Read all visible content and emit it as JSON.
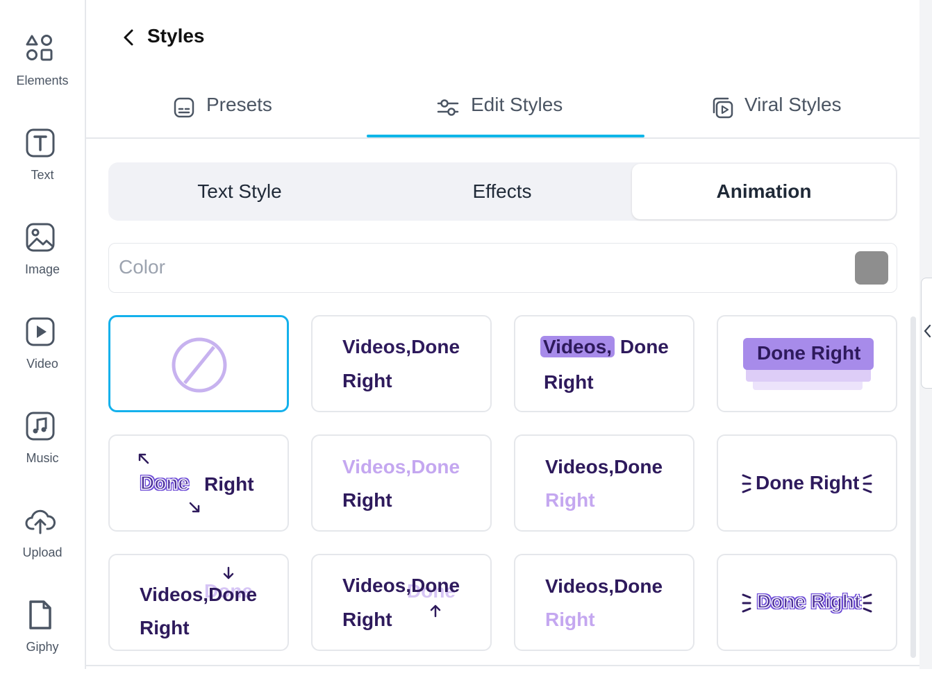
{
  "sidebar": {
    "items": [
      {
        "label": "Elements",
        "icon": "shapes-icon"
      },
      {
        "label": "Text",
        "icon": "text-icon"
      },
      {
        "label": "Image",
        "icon": "image-icon"
      },
      {
        "label": "Video",
        "icon": "video-play-icon"
      },
      {
        "label": "Music",
        "icon": "music-note-icon"
      },
      {
        "label": "Upload",
        "icon": "cloud-upload-icon"
      },
      {
        "label": "Giphy",
        "icon": "file-icon"
      }
    ]
  },
  "header": {
    "title": "Styles",
    "back_icon": "chevron-left-icon"
  },
  "tabs": [
    {
      "label": "Presets",
      "icon": "subtitles-icon"
    },
    {
      "label": "Edit Styles",
      "icon": "sliders-icon",
      "active": true
    },
    {
      "label": "Viral Styles",
      "icon": "copy-video-icon"
    }
  ],
  "subtabs": [
    {
      "label": "Text Style"
    },
    {
      "label": "Effects"
    },
    {
      "label": "Animation",
      "active": true
    }
  ],
  "color": {
    "label": "Color",
    "value": "#8e8e8e"
  },
  "animations": {
    "c2": {
      "line1": "Videos,Done",
      "line2": "Right"
    },
    "c3": {
      "word1": "Videos,",
      "word2": "Done",
      "line2": "Right"
    },
    "c4": {
      "text": "Done Right"
    },
    "c5": {
      "word1": "Done",
      "word2": "Right"
    },
    "c6": {
      "line1": "Videos,Done",
      "line2": "Right"
    },
    "c7": {
      "line1": "Videos,Done",
      "line2": "Right"
    },
    "c8": {
      "text": "Done Right"
    },
    "c9": {
      "line1": "Videos,Done",
      "line2": "Right",
      "ghost": "Done"
    },
    "c10": {
      "line1": "Videos,Done",
      "line2": "Right",
      "ghost": "Done"
    },
    "c11": {
      "line1": "Videos,Done",
      "line2": "Right"
    },
    "c12": {
      "text": "Done Right"
    }
  },
  "colors": {
    "accent": "#14b1ec",
    "text_dark": "#2e1a5c",
    "text_light": "#c4a7f0",
    "highlight": "#a78bea"
  }
}
